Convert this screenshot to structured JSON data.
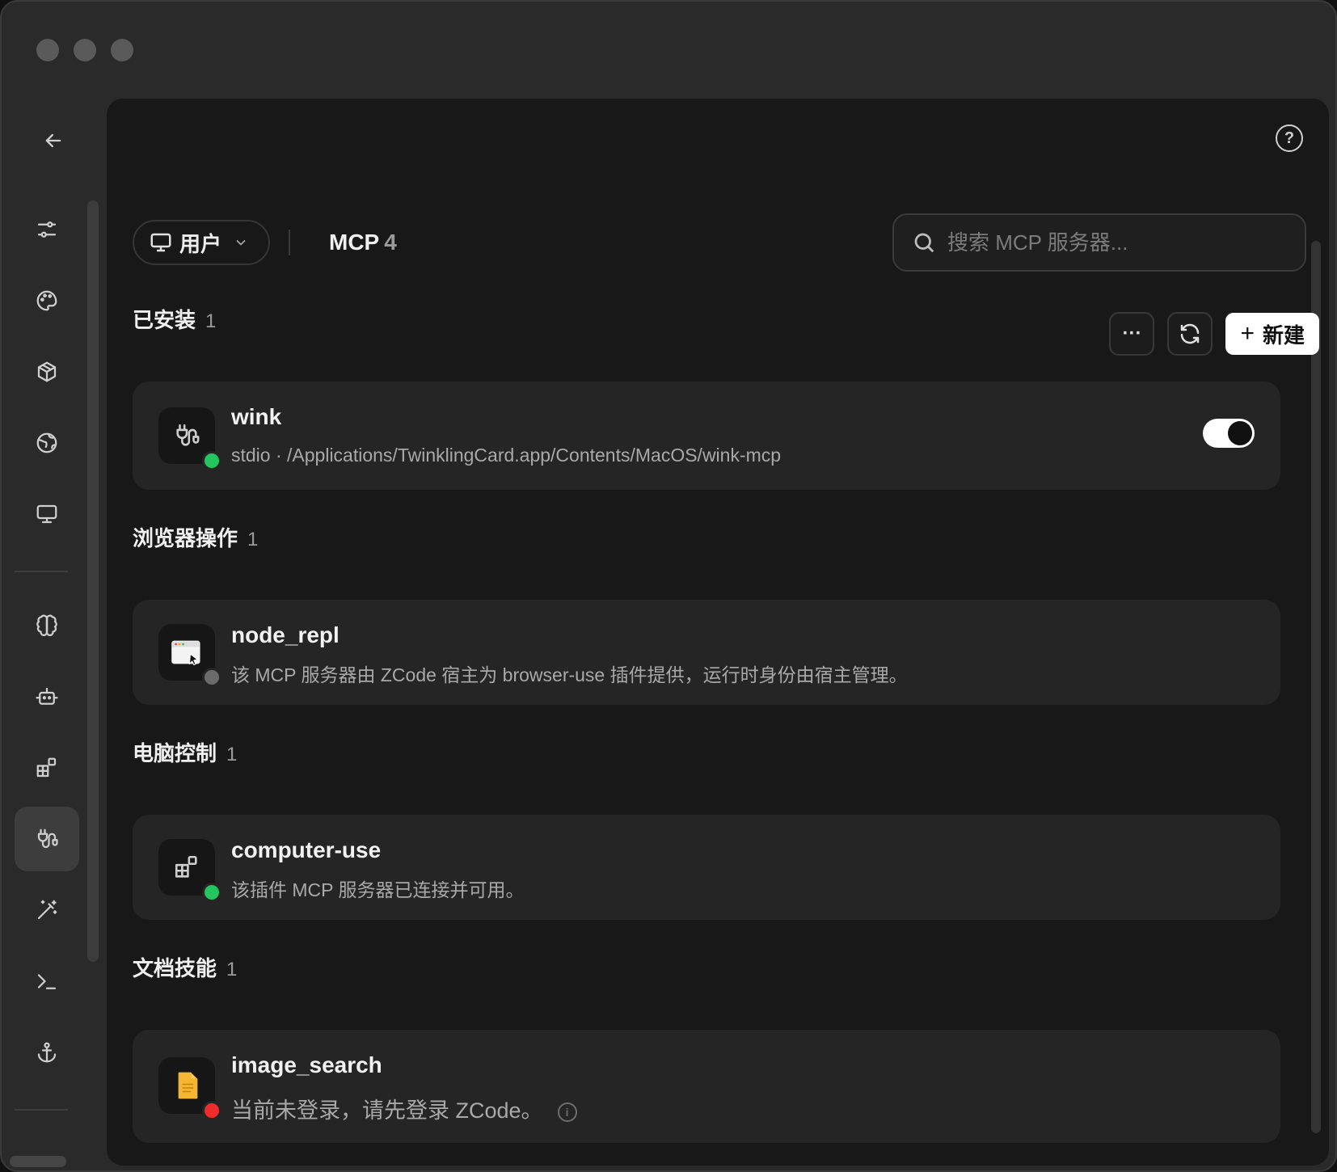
{
  "header": {
    "scope_label": "用户",
    "title": "MCP",
    "title_count": "4",
    "search_placeholder": "搜索 MCP 服务器..."
  },
  "toolbar": {
    "more_label": "···",
    "new_label": "新建"
  },
  "sidebar": {
    "items": [
      {
        "icon": "sliders-icon"
      },
      {
        "icon": "palette-icon"
      },
      {
        "icon": "package-icon"
      },
      {
        "icon": "globe-icon"
      },
      {
        "icon": "monitor-icon"
      },
      {
        "icon": "brain-icon"
      },
      {
        "icon": "robot-icon"
      },
      {
        "icon": "extensions-icon"
      },
      {
        "icon": "plug-icon",
        "active": true
      },
      {
        "icon": "magic-wand-icon"
      },
      {
        "icon": "terminal-icon"
      },
      {
        "icon": "anchor-icon"
      }
    ]
  },
  "sections": [
    {
      "title": "已安装",
      "count": "1",
      "server": {
        "name": "wink",
        "description": "stdio · /Applications/TwinklingCard.app/Contents/MacOS/wink-mcp",
        "status": "connected",
        "enabled": true
      }
    },
    {
      "title": "浏览器操作",
      "count": "1",
      "server": {
        "name": "node_repl",
        "description": "该 MCP 服务器由 ZCode 宿主为 browser-use 插件提供，运行时身份由宿主管理。",
        "status": "managed"
      }
    },
    {
      "title": "电脑控制",
      "count": "1",
      "server": {
        "name": "computer-use",
        "description": "该插件 MCP 服务器已连接并可用。",
        "status": "connected"
      }
    },
    {
      "title": "文档技能",
      "count": "1",
      "server": {
        "name": "image_search",
        "description": "当前未登录，请先登录 ZCode。",
        "status": "error"
      }
    }
  ],
  "colors": {
    "status_connected": "#22c55e",
    "status_managed": "#6b6b6b",
    "status_error": "#ef2b2b",
    "accent_button": "#ffffff"
  }
}
